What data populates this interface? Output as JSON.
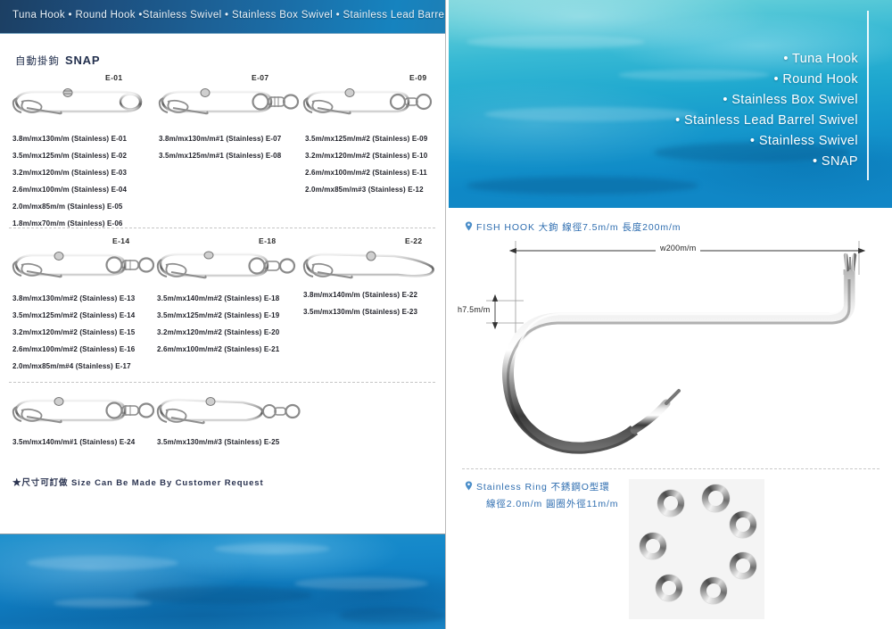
{
  "header": {
    "banner_text": "Tuna Hook • Round Hook •Stainless Swivel • Stainless Box Swivel • Stainless Lead Barrel Swivel",
    "accent_dark": "#1c3f63",
    "accent_light": "#1d7fb6"
  },
  "left": {
    "section_title_cjk": "自動掛鉤",
    "section_title_en": "SNAP",
    "footnote": "★尺寸可訂做 Size Can Be Made By Customer Request",
    "groups": [
      {
        "code": "E-01",
        "specs": [
          "3.8m/mx130m/m (Stainless)  E-01",
          "3.5m/mx125m/m (Stainless)  E-02",
          "3.2m/mx120m/m (Stainless)  E-03",
          "2.6m/mx100m/m (Stainless)  E-04",
          "2.0m/mx85m/m   (Stainless)  E-05",
          "1.8m/mx70m/m   (Stainless)  E-06"
        ]
      },
      {
        "code": "E-07",
        "specs": [
          "3.8m/mx130m/m#1 (Stainless)  E-07",
          "3.5m/mx125m/m#1 (Stainless)  E-08"
        ]
      },
      {
        "code": "E-09",
        "specs": [
          "3.5m/mx125m/m#2 (Stainless)  E-09",
          "3.2m/mx120m/m#2 (Stainless)  E-10",
          "2.6m/mx100m/m#2 (Stainless)  E-11",
          "2.0m/mx85m/m#3   (Stainless)  E-12"
        ]
      },
      {
        "code": "E-14",
        "specs": [
          "3.8m/mx130m/m#2 (Stainless)  E-13",
          "3.5m/mx125m/m#2 (Stainless)  E-14",
          "3.2m/mx120m/m#2 (Stainless)  E-15",
          "2.6m/mx100m/m#2 (Stainless)  E-16",
          "2.0m/mx85m/m#4 (Stainless)    E-17"
        ]
      },
      {
        "code": "E-18",
        "specs": [
          "3.5m/mx140m/m#2 (Stainless)  E-18",
          "3.5m/mx125m/m#2 (Stainless)  E-19",
          "3.2m/mx120m/m#2 (Stainless)  E-20",
          "2.6m/mx100m/m#2 (Stainless)  E-21"
        ]
      },
      {
        "code": "E-22",
        "specs": [
          "3.8m/mx140m/m     (Stainless)  E-22",
          "3.5m/mx130m/m     (Stainless)  E-23"
        ]
      },
      {
        "code": "",
        "specs": [
          "3.5m/mx140m/m#1 (Stainless)  E-24"
        ]
      },
      {
        "code": "",
        "specs": [
          "3.5m/mx130m/m#3 (Stainless)  E-25"
        ]
      }
    ]
  },
  "right": {
    "bullets": [
      "Tuna Hook",
      "Round Hook",
      "Stainless Box Swivel",
      "Stainless Lead Barrel Swivel",
      "Stainless Swivel",
      "SNAP"
    ],
    "fish_hook": {
      "heading": "FISH HOOK 大鉤  線徑7.5m/m  長度200m/m",
      "width_dim": "w200m/m",
      "height_dim": "h7.5m/m"
    },
    "stainless_ring": {
      "heading_line1": "Stainless Ring 不銹鋼O型環",
      "heading_line2": "線徑2.0m/m 圓圈外徑11m/m",
      "ring_count": 7
    }
  }
}
